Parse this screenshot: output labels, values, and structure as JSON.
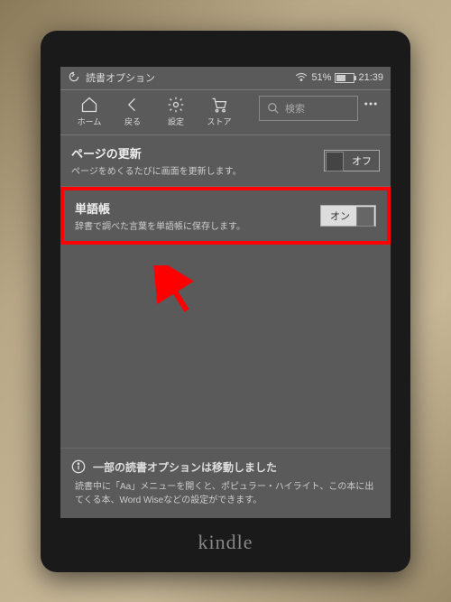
{
  "statusbar": {
    "title": "読書オプション",
    "battery_percent": "51%",
    "time": "21:39"
  },
  "navbar": {
    "home": "ホーム",
    "back": "戻る",
    "settings": "設定",
    "store": "ストア",
    "search_placeholder": "検索"
  },
  "settings": {
    "page_refresh": {
      "title": "ページの更新",
      "desc": "ページをめくるたびに画面を更新します。",
      "state": "オフ"
    },
    "vocab": {
      "title": "単語帳",
      "desc": "辞書で調べた言葉を単語帳に保存します。",
      "state": "オン"
    }
  },
  "info": {
    "title": "一部の読書オプションは移動しました",
    "body": "読書中に「Aa」メニューを開くと、ポピュラー・ハイライト、この本に出てくる本、Word Wiseなどの設定ができます。"
  },
  "brand": "kindle"
}
